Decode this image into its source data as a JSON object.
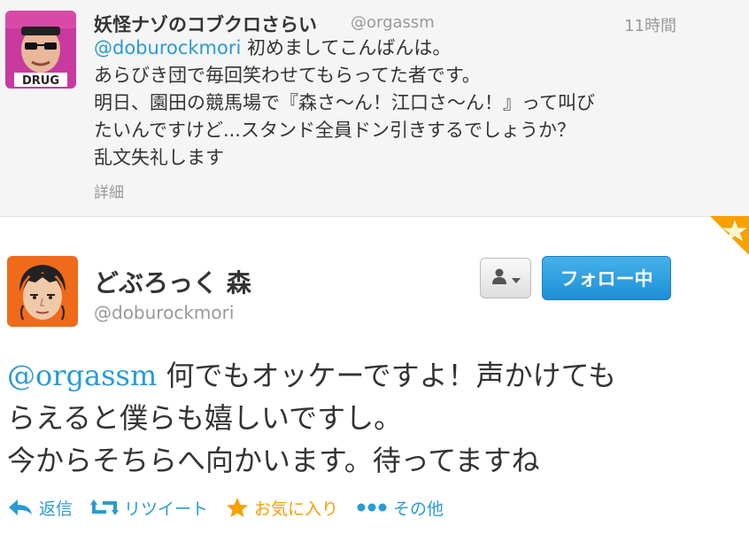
{
  "reply": {
    "name": "妖怪ナゾのコブクロさらい",
    "handle": "@orgassm",
    "time": "11時間",
    "mention": "@doburockmori",
    "line1_rest": " 初めましてこんばんは。",
    "line2": "あらびき団で毎回笑わせてもらってた者です。",
    "line3": "明日、園田の競馬場で『森さ〜ん！江口さ〜ん！』って叫び",
    "line4": "たいんですけど...スタンド全員ドン引きするでしょうか？",
    "line5": "乱文失礼します",
    "detail": "詳細",
    "avatar_text": "DRUG"
  },
  "tweet": {
    "name": "どぶろっく 森",
    "handle": "@doburockmori",
    "mention": "@orgassm",
    "line1_rest": " 何でもオッケーですよ！声かけても",
    "line2": "らえると僕らも嬉しいですし。",
    "line3": "今からそちらへ向かいます。待ってますね"
  },
  "buttons": {
    "follow": "フォロー中"
  },
  "actions": {
    "reply": "返信",
    "retweet": "リツイート",
    "favorite": "お気に入り",
    "more": "その他"
  },
  "colors": {
    "link": "#2a9bd3",
    "follow_button": "#1d8fd6",
    "star_orange": "#f7a000"
  }
}
